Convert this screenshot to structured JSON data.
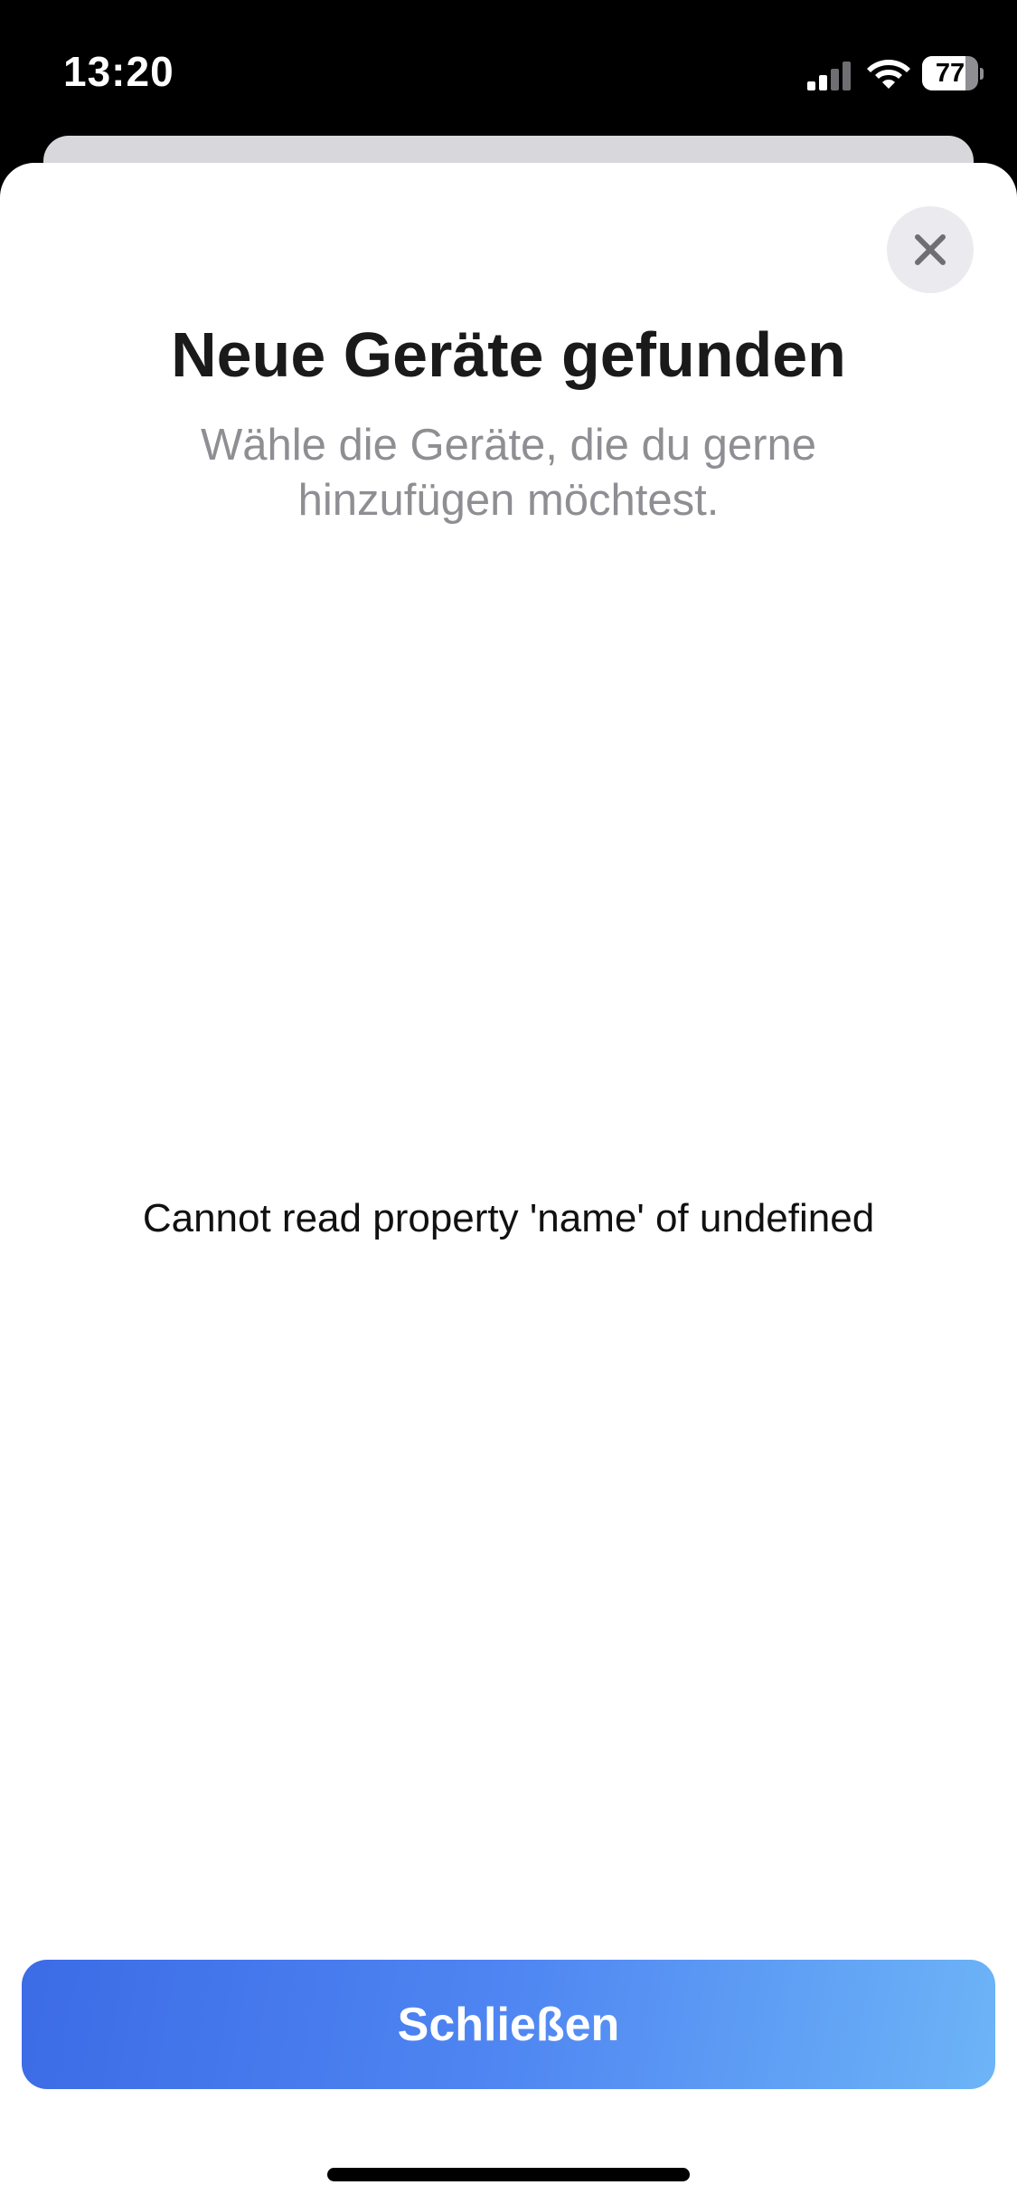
{
  "status_bar": {
    "time": "13:20",
    "battery_level": "77",
    "battery_fraction": 0.77,
    "signal_icon": "cellular-signal-icon",
    "wifi_icon": "wifi-icon"
  },
  "sheet": {
    "title": "Neue Geräte gefunden",
    "subtitle": "Wähle die Geräte, die du gerne hinzufügen möchtest.",
    "close_icon": "close-icon",
    "error_message": "Cannot read property 'name' of undefined",
    "primary_button_label": "Schließen"
  },
  "colors": {
    "accent_start": "#3c6be6",
    "accent_end": "#6db4f7",
    "subtitle_gray": "#8e8e93",
    "close_bg": "#ebebef"
  }
}
